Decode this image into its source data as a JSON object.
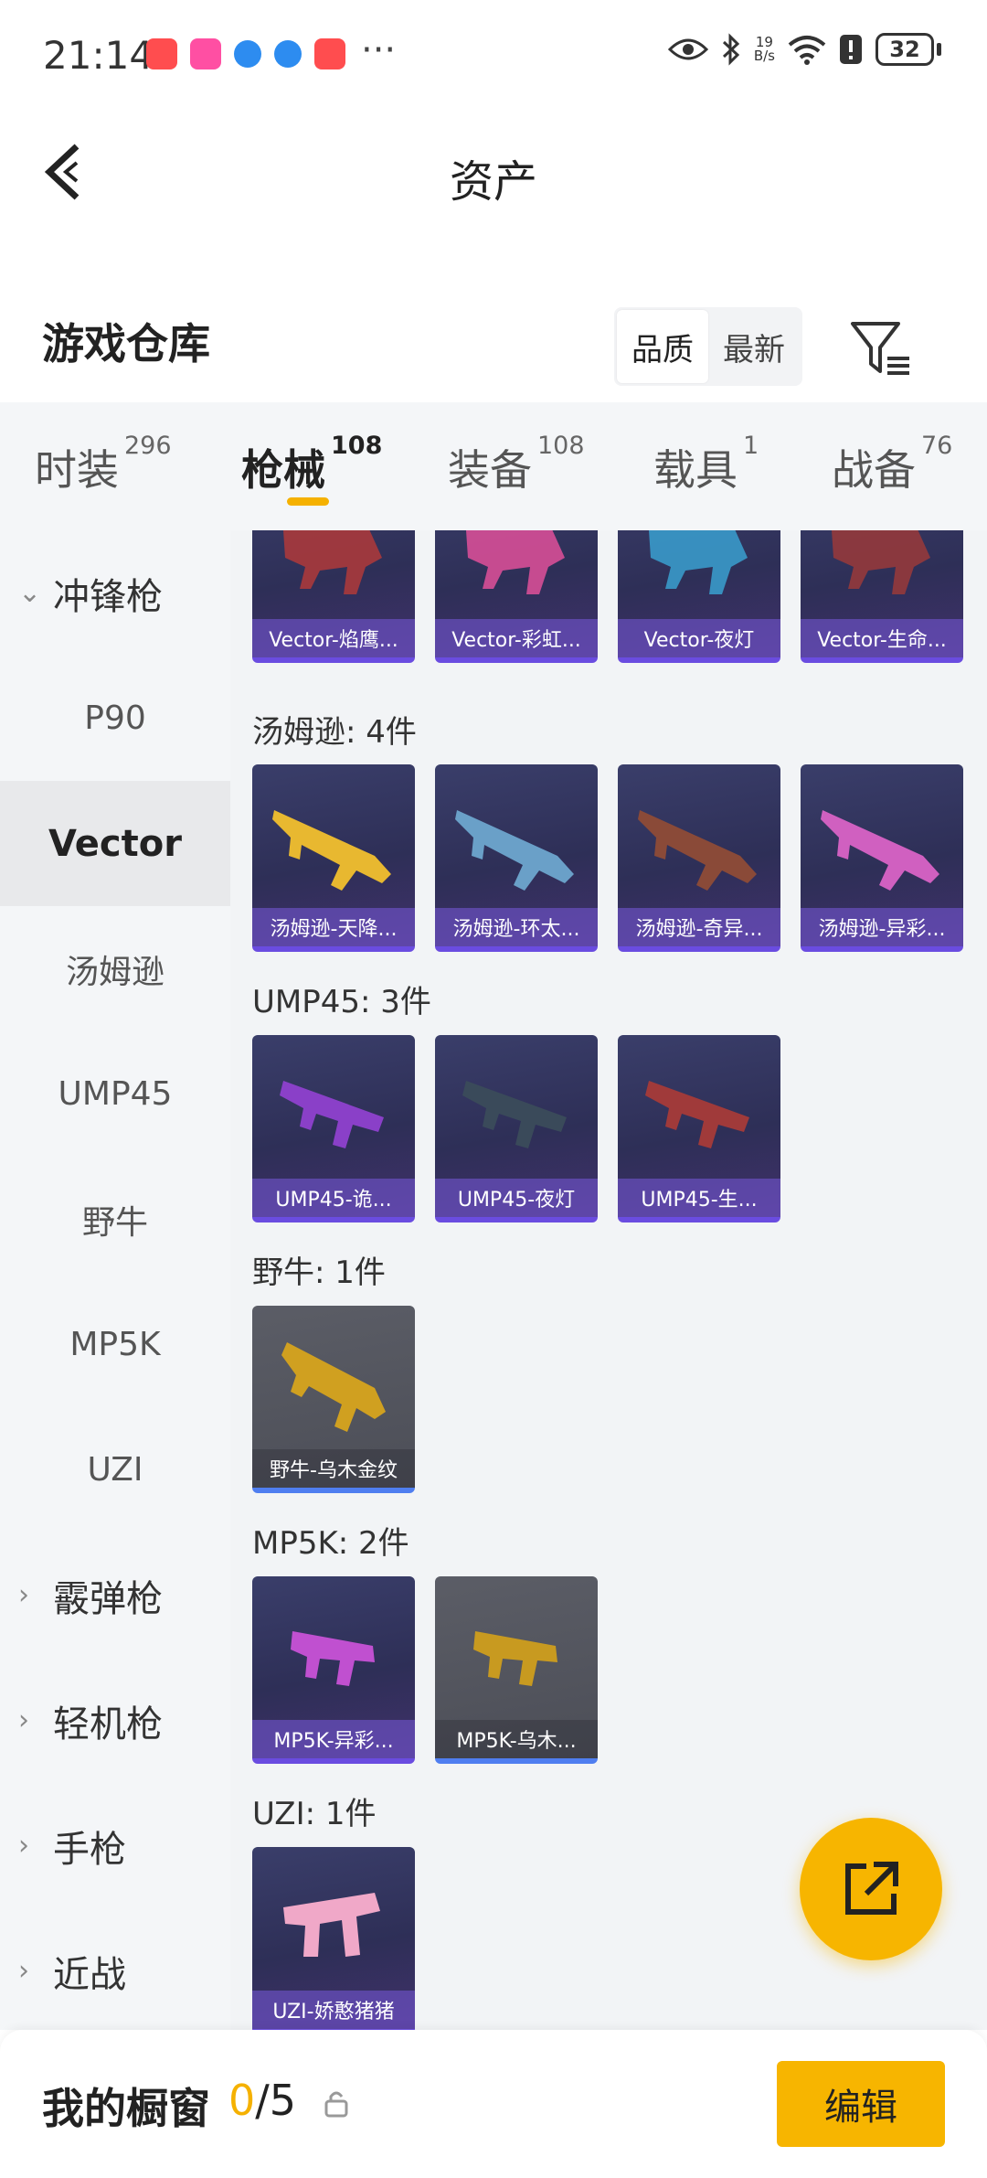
{
  "status_bar": {
    "time": "21:14",
    "more": "···",
    "net_speed_top": "19",
    "net_speed_unit": "B/s",
    "battery": "32"
  },
  "header": {
    "title": "资产"
  },
  "warehouse": {
    "title": "游戏仓库",
    "sort_quality": "品质",
    "sort_newest": "最新"
  },
  "tabs": [
    {
      "label": "时装",
      "count": "296"
    },
    {
      "label": "枪械",
      "count": "108"
    },
    {
      "label": "装备",
      "count": "108"
    },
    {
      "label": "载具",
      "count": "1"
    },
    {
      "label": "战备",
      "count": "76"
    }
  ],
  "sidebar": {
    "category_smg": "冲锋枪",
    "items": [
      "P90",
      "Vector",
      "汤姆逊",
      "UMP45",
      "野牛",
      "MP5K",
      "UZI"
    ],
    "category_shotgun": "霰弹枪",
    "category_lmg": "轻机枪",
    "category_pistol": "手枪",
    "category_melee": "近战"
  },
  "content": {
    "vector_cards": [
      "Vector-焰鹰...",
      "Vector-彩虹...",
      "Vector-夜灯",
      "Vector-生命..."
    ],
    "thompson_label": "汤姆逊: 4件",
    "thompson_cards": [
      "汤姆逊-天降...",
      "汤姆逊-环太...",
      "汤姆逊-奇异...",
      "汤姆逊-异彩..."
    ],
    "ump_label": "UMP45: 3件",
    "ump_cards": [
      "UMP45-诡...",
      "UMP45-夜灯",
      "UMP45-生..."
    ],
    "bison_label": "野牛: 1件",
    "bison_cards": [
      "野牛-乌木金纹"
    ],
    "mp5k_label": "MP5K: 2件",
    "mp5k_cards": [
      "MP5K-异彩...",
      "MP5K-乌木..."
    ],
    "uzi_label": "UZI: 1件",
    "uzi_cards": [
      "UZI-娇憨猪猪"
    ]
  },
  "bottom_bar": {
    "label": "我的橱窗",
    "current": "0",
    "total": "/5",
    "edit_label": "编辑"
  },
  "colors": {
    "accent": "#f7b500",
    "card_purple": "#2e2f57",
    "card_gray": "#4c4e57"
  }
}
